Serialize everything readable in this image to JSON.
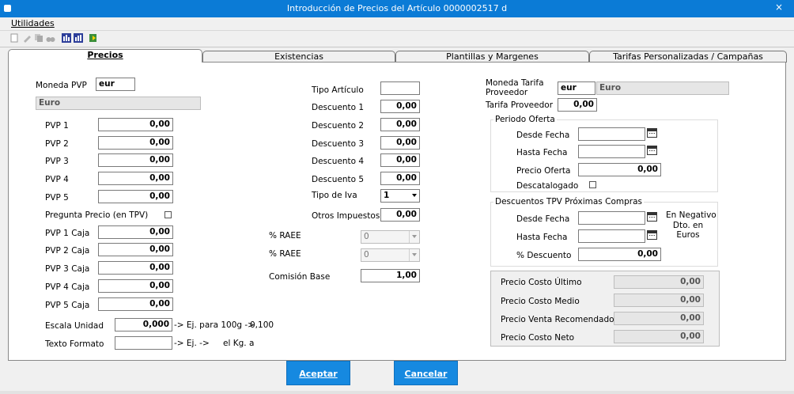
{
  "window": {
    "title": "Introducción de Precios del Artículo  0000002517 d",
    "close_label": "×"
  },
  "menu": {
    "utilidades": "Utilidades"
  },
  "tabs": [
    {
      "label": "Precios",
      "active": true
    },
    {
      "label": "Existencias"
    },
    {
      "label": "Plantillas y Margenes"
    },
    {
      "label": "Tarifas Personalizadas / Campañas"
    }
  ],
  "left": {
    "moneda_pvp_label": "Moneda PVP",
    "moneda_pvp_value": "eur",
    "moneda_desc": "Euro",
    "pvp": [
      {
        "label": "PVP 1",
        "value": "0,00"
      },
      {
        "label": "PVP 2",
        "value": "0,00"
      },
      {
        "label": "PVP 3",
        "value": "0,00"
      },
      {
        "label": "PVP 4",
        "value": "0,00"
      },
      {
        "label": "PVP 5",
        "value": "0,00"
      }
    ],
    "pregunta_precio_label": "Pregunta Precio (en TPV)",
    "pvp_caja": [
      {
        "label": "PVP 1 Caja",
        "value": "0,00"
      },
      {
        "label": "PVP 2 Caja",
        "value": "0,00"
      },
      {
        "label": "PVP 3 Caja",
        "value": "0,00"
      },
      {
        "label": "PVP 4 Caja",
        "value": "0,00"
      },
      {
        "label": "PVP 5 Caja",
        "value": "0,00"
      }
    ],
    "escala_label": "Escala Unidad",
    "escala_value": "0,000",
    "escala_hint": "-> Ej. para 100g ->",
    "escala_example": "0,100",
    "texto_label": "Texto Formato",
    "texto_value": "",
    "texto_hint": "-> Ej. ->",
    "texto_example": "el Kg. a"
  },
  "middle": {
    "tipo_articulo_label": "Tipo Artículo",
    "tipo_articulo_value": "",
    "descuentos": [
      {
        "label": "Descuento 1",
        "value": "0,00"
      },
      {
        "label": "Descuento 2",
        "value": "0,00"
      },
      {
        "label": "Descuento 3",
        "value": "0,00"
      },
      {
        "label": "Descuento 4",
        "value": "0,00"
      },
      {
        "label": "Descuento 5",
        "value": "0,00"
      }
    ],
    "tipo_iva_label": "Tipo de Iva",
    "tipo_iva_value": "1",
    "otros_impuestos_label": "Otros Impuestos",
    "otros_impuestos_value": "0,00",
    "raee": [
      {
        "label": "% RAEE",
        "value": "0"
      },
      {
        "label": "% RAEE",
        "value": "0"
      }
    ],
    "comision_label": "Comisión Base",
    "comision_value": "1,00"
  },
  "right": {
    "moneda_tarifa_label_1": "Moneda Tarifa",
    "moneda_tarifa_label_2": "Proveedor",
    "moneda_tarifa_value": "eur",
    "moneda_tarifa_desc": "Euro",
    "tarifa_proveedor_label": "Tarifa Proveedor",
    "tarifa_proveedor_value": "0,00",
    "periodo_oferta": {
      "title": "Periodo Oferta",
      "desde_label": "Desde Fecha",
      "desde_value": "",
      "hasta_label": "Hasta Fecha",
      "hasta_value": "",
      "precio_label": "Precio Oferta",
      "precio_value": "0,00",
      "descatalogado_label": "Descatalogado"
    },
    "descuentos_tpv": {
      "title": "Descuentos TPV Próximas Compras",
      "desde_label": "Desde Fecha",
      "desde_value": "",
      "hasta_label": "Hasta Fecha",
      "hasta_value": "",
      "pct_label": "% Descuento",
      "pct_value": "0,00",
      "note_1": "En Negativo",
      "note_2": "Dto. en",
      "note_3": "Euros"
    },
    "costes": [
      {
        "label": "Precio Costo Último",
        "value": "0,00"
      },
      {
        "label": "Precio Costo Medio",
        "value": "0,00"
      },
      {
        "label": "Precio Venta Recomendado",
        "value": "0,00"
      },
      {
        "label": "Precio Costo Neto",
        "value": "0,00"
      }
    ]
  },
  "buttons": {
    "aceptar": "Aceptar",
    "cancelar": "Cancelar"
  },
  "colors": {
    "titlebar": "#0b7bd6",
    "button": "#1689e0"
  }
}
